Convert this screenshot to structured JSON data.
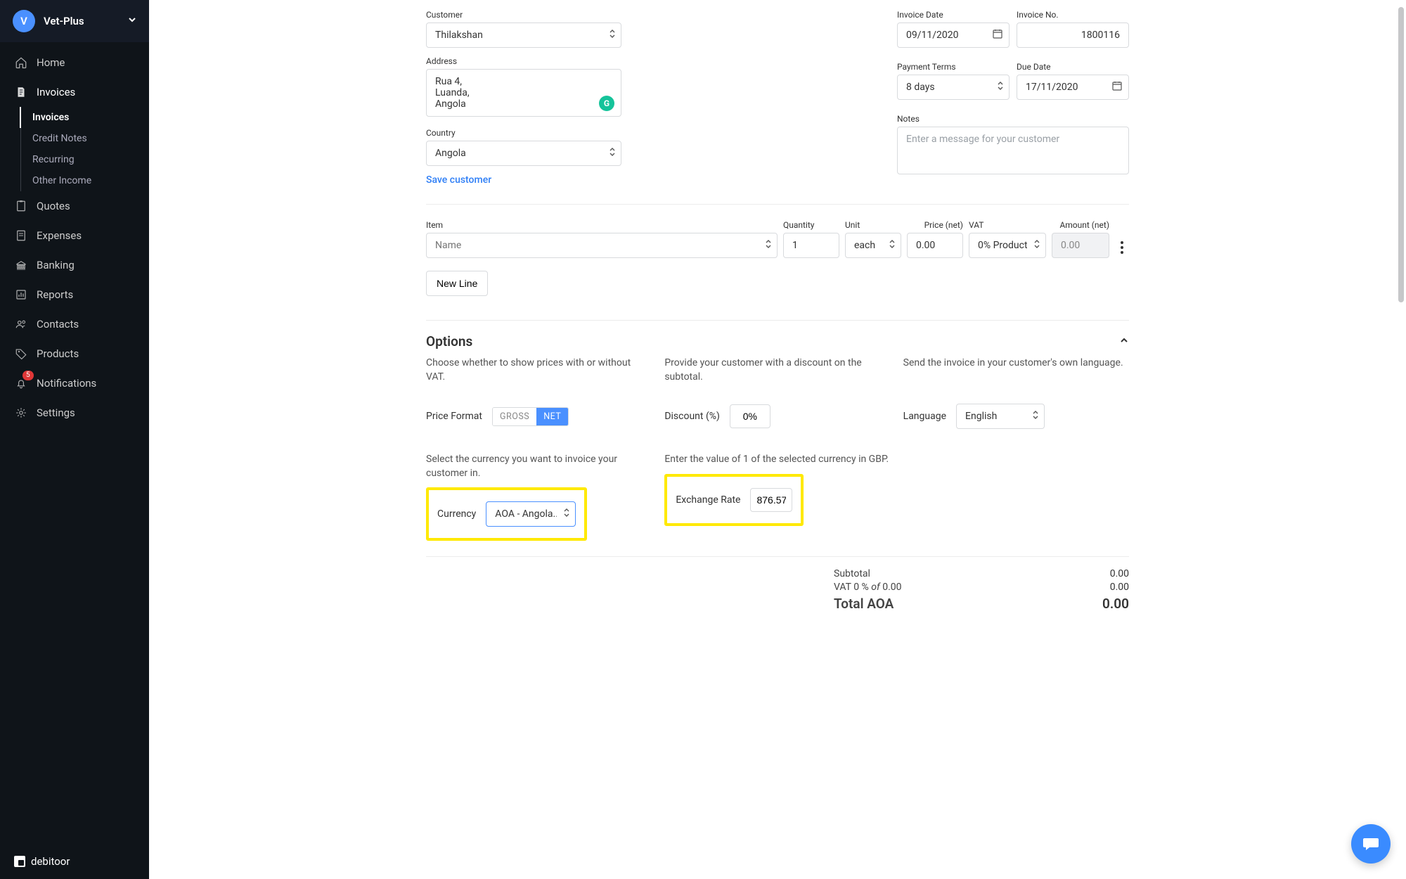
{
  "org": {
    "initial": "V",
    "name": "Vet-Plus"
  },
  "nav": {
    "home": "Home",
    "invoices": "Invoices",
    "sub_invoices": "Invoices",
    "sub_credit": "Credit Notes",
    "sub_recurring": "Recurring",
    "sub_other": "Other Income",
    "quotes": "Quotes",
    "expenses": "Expenses",
    "banking": "Banking",
    "reports": "Reports",
    "contacts": "Contacts",
    "products": "Products",
    "notifications": "Notifications",
    "notif_badge": "5",
    "settings": "Settings"
  },
  "brand": "debitoor",
  "form": {
    "customer_label": "Customer",
    "customer": "Thilakshan",
    "address_label": "Address",
    "address": "Rua 4,\nLuanda,\nAngola",
    "country_label": "Country",
    "country": "Angola",
    "save_customer": "Save customer",
    "invoice_date_label": "Invoice Date",
    "invoice_date": "09/11/2020",
    "invoice_no_label": "Invoice No.",
    "invoice_no": "1800116",
    "terms_label": "Payment Terms",
    "terms": "8 days",
    "due_label": "Due Date",
    "due": "17/11/2020",
    "notes_label": "Notes",
    "notes_ph": "Enter a message for your customer"
  },
  "items": {
    "h_item": "Item",
    "h_qty": "Quantity",
    "h_unit": "Unit",
    "h_price": "Price (net)",
    "h_vat": "VAT",
    "h_amount": "Amount (net)",
    "line": {
      "name_ph": "Name",
      "qty": "1",
      "unit": "each",
      "price": "0.00",
      "vat": "0% Product",
      "amount": "0.00"
    },
    "new_line": "New Line"
  },
  "options": {
    "title": "Options",
    "vat_help": "Choose whether to show prices with or without VAT.",
    "discount_help": "Provide your customer with a discount on the subtotal.",
    "lang_help": "Send the invoice in your customer's own language.",
    "price_format": "Price Format",
    "gross": "GROSS",
    "net": "NET",
    "discount_label": "Discount (%)",
    "discount": "0%",
    "lang_label": "Language",
    "lang": "English",
    "currency_help": "Select the currency you want to invoice your customer in.",
    "exchange_help": "Enter the value of 1 of the selected currency in GBP.",
    "currency_label": "Currency",
    "currency": "AOA - Angola...",
    "exchange_label": "Exchange Rate",
    "exchange": "876.570"
  },
  "totals": {
    "subtotal_l": "Subtotal",
    "subtotal_v": "0.00",
    "vat_l_a": "VAT 0 % ",
    "vat_l_b": "of ",
    "vat_l_c": "0.00",
    "vat_v": "0.00",
    "total_l": "Total AOA",
    "total_v": "0.00"
  }
}
